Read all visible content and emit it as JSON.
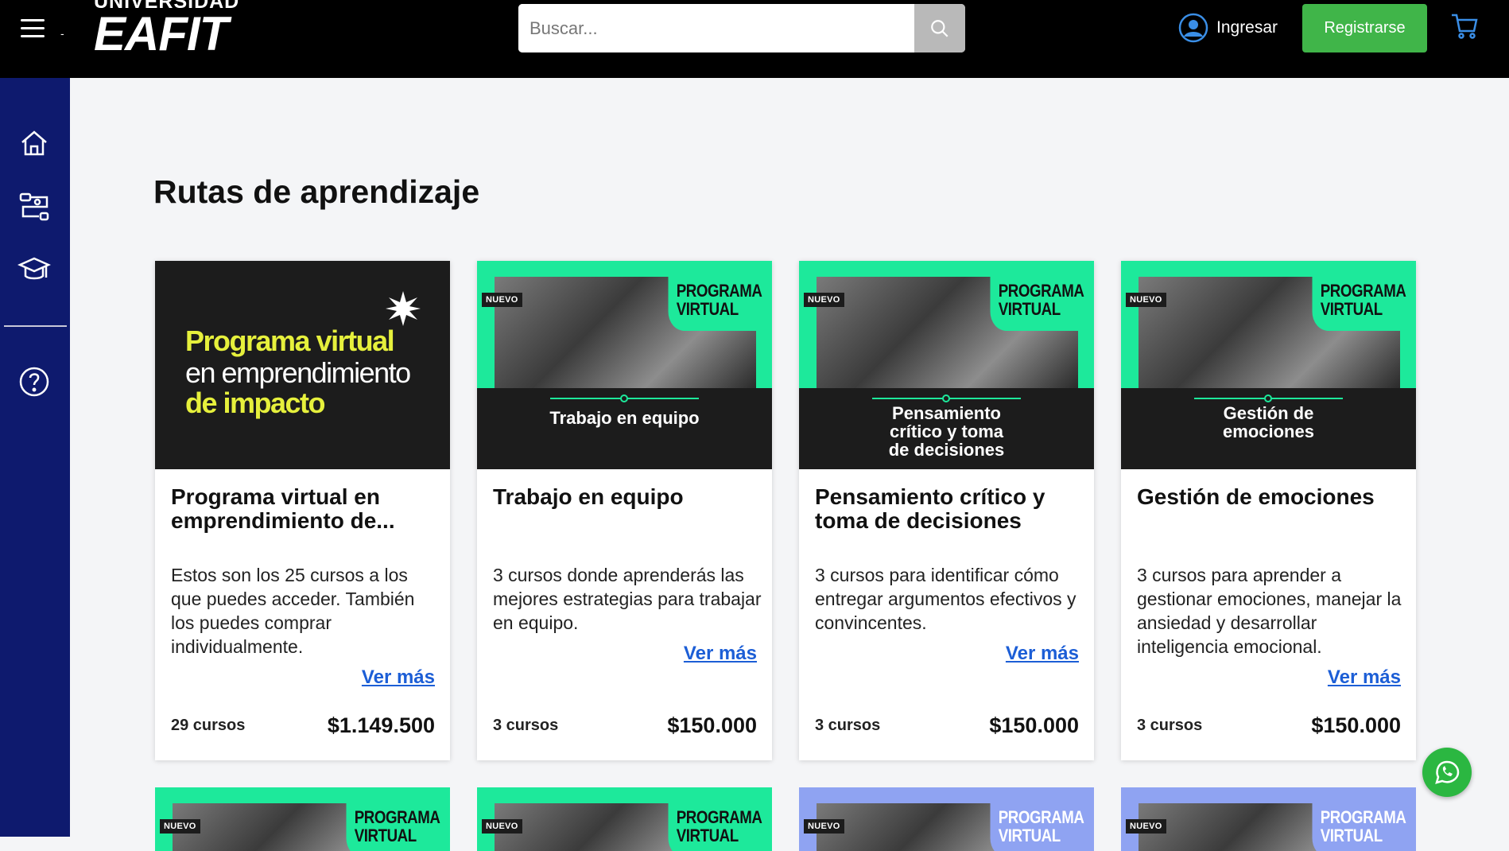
{
  "header": {
    "dash": "-",
    "logo_line1": "UNIVERSIDAD",
    "logo_line2": "EAFIT",
    "search_placeholder": "Buscar...",
    "login_label": "Ingresar",
    "register_label": "Registrarse"
  },
  "main": {
    "title": "Rutas de aprendizaje"
  },
  "cards": [
    {
      "thumb_lines": [
        "Programa virtual",
        "en emprendimiento",
        "de impacto"
      ],
      "title": "Programa virtual en emprendimiento de...",
      "description": "Estos son los 25 cursos a los que puedes acceder. También los puedes comprar individualmente.",
      "link": "Ver más",
      "count": "29 cursos",
      "price": "$1.149.500"
    },
    {
      "badge": "NUEVO",
      "program_label": "PROGRAMA VIRTUAL",
      "band_text": "Trabajo en equipo",
      "title": "Trabajo en equipo",
      "description": "3 cursos donde aprenderás las mejores estrategias para trabajar en equipo.",
      "link": "Ver más",
      "count": "3 cursos",
      "price": "$150.000"
    },
    {
      "badge": "NUEVO",
      "program_label": "PROGRAMA VIRTUAL",
      "band_text": "Pensamiento crítico y toma de decisiones",
      "title": "Pensamiento crítico y toma de decisiones",
      "description": "3 cursos para identificar cómo entregar argumentos efectivos y convincentes.",
      "link": "Ver más",
      "count": "3 cursos",
      "price": "$150.000"
    },
    {
      "badge": "NUEVO",
      "program_label": "PROGRAMA VIRTUAL",
      "band_text": "Gestión de emociones",
      "title": "Gestión de emociones",
      "description": "3 cursos para aprender a gestionar emociones, manejar la ansiedad y desarrollar inteligencia emocional.",
      "link": "Ver más",
      "count": "3 cursos",
      "price": "$150.000"
    }
  ],
  "row2": [
    {
      "badge": "NUEVO",
      "program_label": "PROGRAMA VIRTUAL",
      "theme": "#1de99b"
    },
    {
      "badge": "NUEVO",
      "program_label": "PROGRAMA VIRTUAL",
      "theme": "#1de99b"
    },
    {
      "badge": "NUEVO",
      "program_label": "PROGRAMA VIRTUAL",
      "theme": "#8fa3f2"
    },
    {
      "badge": "NUEVO",
      "program_label": "PROGRAMA VIRTUAL",
      "theme": "#8fa3f2"
    }
  ],
  "icons": {
    "menu": "hamburger-menu-icon",
    "search": "search-icon",
    "user": "user-circle-icon",
    "cart": "shopping-cart-icon",
    "home": "home-icon",
    "routes": "learning-routes-icon",
    "graduation": "graduation-cap-icon",
    "help": "help-circle-icon",
    "whatsapp": "whatsapp-icon"
  },
  "colors": {
    "header_bg": "#000000",
    "sidebar_bg": "#0e1a6e",
    "accent_green": "#1de99b",
    "register_green": "#40b549",
    "link_blue": "#1c5ed6",
    "lavender": "#8fa3f2"
  }
}
